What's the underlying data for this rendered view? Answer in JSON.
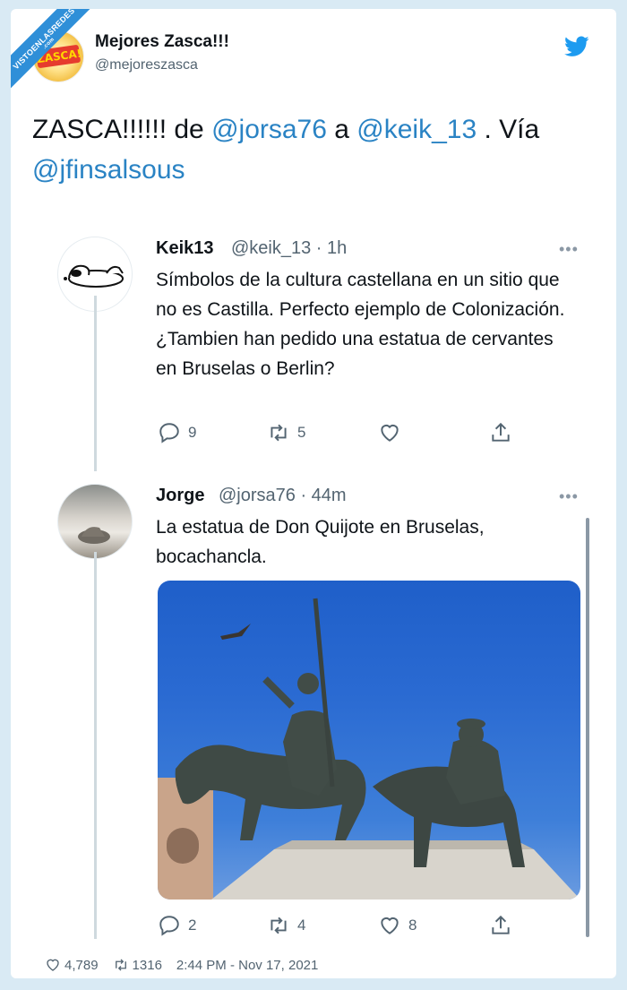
{
  "watermark": {
    "text": "VISTOENLASREDES",
    "sub": ".com"
  },
  "outer_tweet": {
    "name": "Mejores Zasca!!!",
    "handle": "@mejoreszasca",
    "logo_text": "ZASCA!",
    "text_parts": {
      "p1": "ZASCA!!!!!! de ",
      "m1": "@jorsa76",
      "p2": " a ",
      "m2": "@keik_13",
      "p3": " . Vía ",
      "m3": "@jfinsalsous"
    },
    "footer": {
      "likes": "4,789",
      "retweets": "1316",
      "datetime": "2:44 PM - Nov 17, 2021"
    }
  },
  "tweet1": {
    "name": "Keik13",
    "meta": "@keik_13 · 1h",
    "body": "Símbolos de la cultura castellana en un sitio que no es Castilla. Perfecto ejemplo de Colonización. ¿Tambien han pedido una estatua de cervantes en Bruselas o Berlin?",
    "replies": "9",
    "retweets": "5",
    "likes": ""
  },
  "tweet2": {
    "name": "Jorge",
    "meta": "@jorsa76 · 44m",
    "body": "La estatua de Don Quijote en Bruselas, bocachancla.",
    "replies": "2",
    "retweets": "4",
    "likes": "8"
  },
  "icons": [
    "twitter-bird-icon",
    "reply-icon",
    "retweet-icon",
    "like-icon",
    "share-icon",
    "more-icon"
  ],
  "colors": {
    "link": "#2a83c4",
    "background": "#d9eaf4",
    "twitter_blue": "#1d9bf0",
    "watermark": "#2f8fd8"
  }
}
